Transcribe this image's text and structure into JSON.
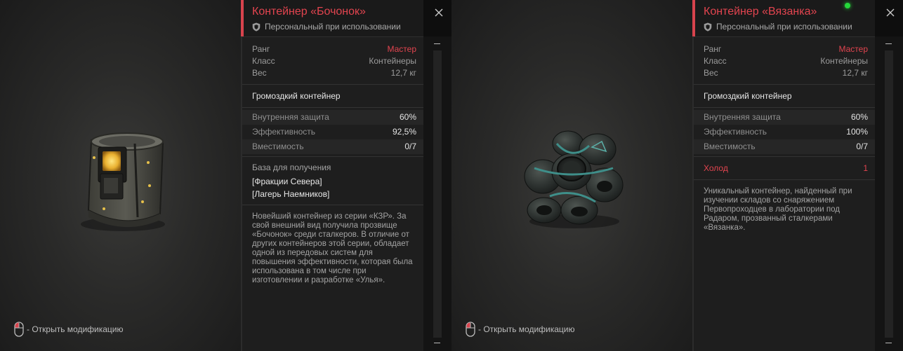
{
  "cards": [
    {
      "title": "Контейнер «Бочонок»",
      "subtitle": "Персональный при использовании",
      "mouse_hint": "- Открыть модификацию",
      "stats": [
        {
          "label": "Ранг",
          "value": "Мастер"
        },
        {
          "label": "Класс",
          "value": "Контейнеры"
        },
        {
          "label": "Вес",
          "value": "12,7 кг"
        }
      ],
      "type": "Громоздкий контейнер",
      "props": [
        {
          "label": "Внутренняя защита",
          "value": "60%"
        },
        {
          "label": "Эффективность",
          "value": "92,5%"
        },
        {
          "label": "Вместимость",
          "value": "0/7"
        }
      ],
      "base": {
        "title": "База для получения",
        "items": [
          "[Фракции Севера]",
          "[Лагерь Наемников]"
        ]
      },
      "description": "Новейший контейнер из серии «КЗР». За свой внешний вид получила прозвище «Бочонок» среди сталкеров. В отличие от других контейнеров этой серии, обладает одной из передовых систем для повышения эффективности, которая была использована в том числе при изготовлении и разработке «Улья»."
    },
    {
      "title": "Контейнер «Вязанка»",
      "subtitle": "Персональный при использовании",
      "mouse_hint": "- Открыть модификацию",
      "stats": [
        {
          "label": "Ранг",
          "value": "Мастер"
        },
        {
          "label": "Класс",
          "value": "Контейнеры"
        },
        {
          "label": "Вес",
          "value": "12,7 кг"
        }
      ],
      "type": "Громоздкий контейнер",
      "props": [
        {
          "label": "Внутренняя защита",
          "value": "60%"
        },
        {
          "label": "Эффективность",
          "value": "100%"
        },
        {
          "label": "Вместимость",
          "value": "0/7"
        }
      ],
      "special": {
        "label": "Холод",
        "value": "1"
      },
      "description": "Уникальный контейнер, найденный при изучении складов со снаряжением Первопроходцев в лаборатории под Радаром, прозванный сталкерами «Вязанка»."
    }
  ],
  "colors": {
    "accent": "#e2444f",
    "panel_bg": "#1e1e1e",
    "image_bg": "#2a2a29",
    "status_led": "#25d83a"
  },
  "icons": {
    "shield": "shield-icon",
    "close": "close-icon",
    "mouse": "mouse-icon"
  }
}
